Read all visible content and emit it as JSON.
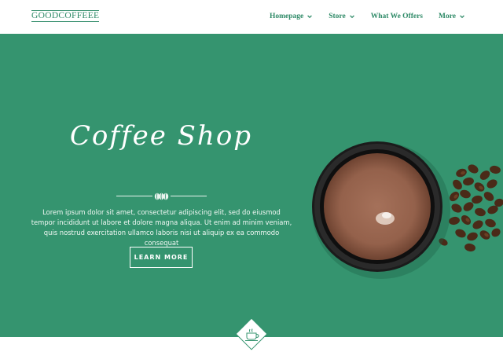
{
  "header": {
    "logo": "GOODCOFFEEE",
    "nav": [
      {
        "label": "Homepage",
        "has_dropdown": true
      },
      {
        "label": "Store",
        "has_dropdown": true
      },
      {
        "label": "What We Offers",
        "has_dropdown": false
      },
      {
        "label": "More",
        "has_dropdown": true
      }
    ]
  },
  "hero": {
    "title": "Coffee Shop",
    "paragraph": "Lorem ipsum dolor sit amet, consectetur adipiscing elit, sed do eiusmod tempor incididunt ut labore et dolore magna aliqua. Ut enim ad minim veniam, quis nostrud exercitation ullamco laboris nisi ut aliquip ex ea commodo consequat",
    "button_label": "LEARN MORE",
    "image": "coffee-cup-with-beans",
    "background_color": "#35946f"
  },
  "icons": {
    "divider": "coffee-beans-icon",
    "bottom_badge": "coffee-cup-icon"
  }
}
